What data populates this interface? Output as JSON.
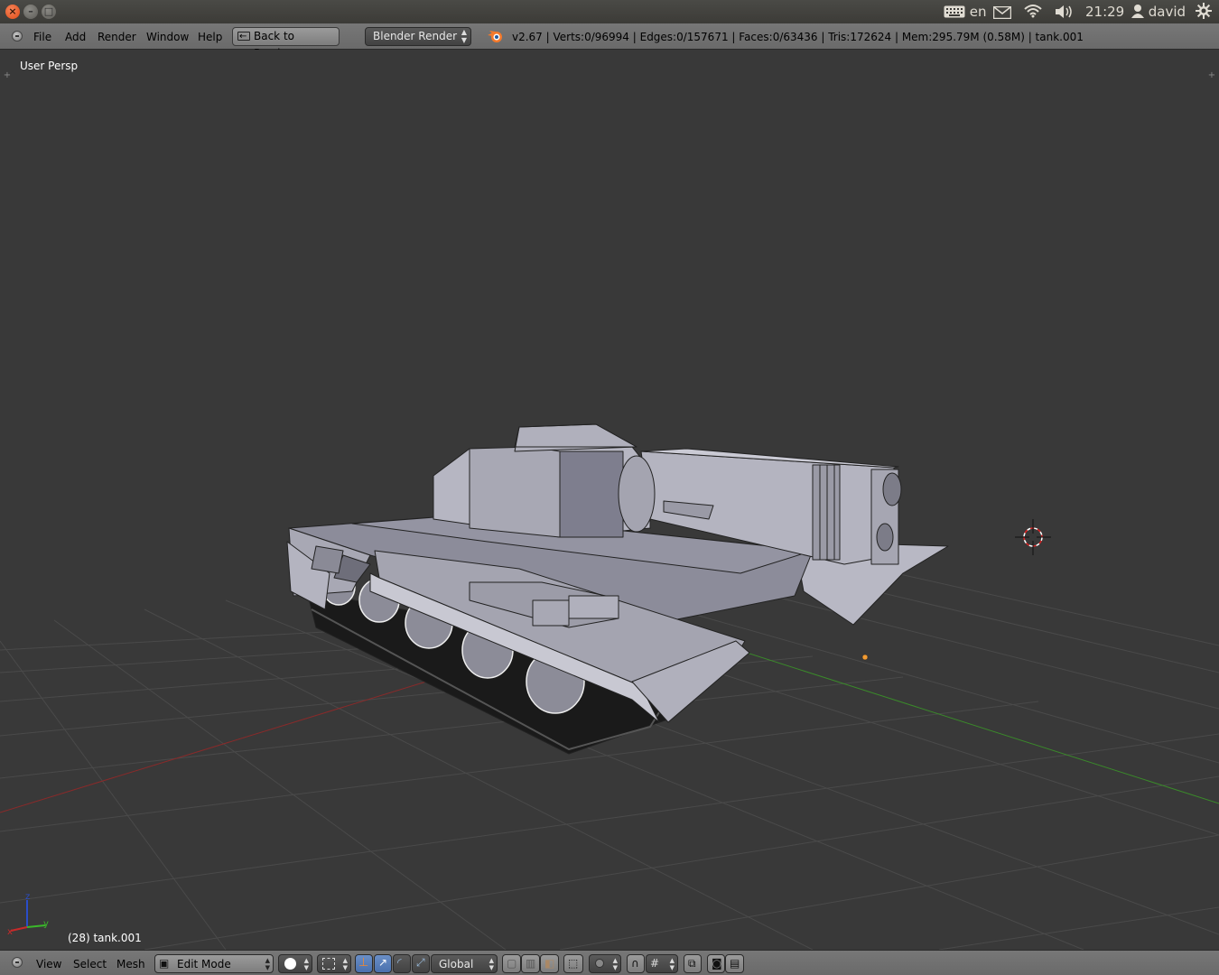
{
  "os_bar": {
    "window_buttons": {
      "close": "×",
      "minimize": "–",
      "maximize": "□"
    },
    "keyboard_layout": "en",
    "time": "21:29",
    "user": "david",
    "icons": [
      "keyboard-icon",
      "mail-icon",
      "wifi-icon",
      "volume-icon",
      "user-icon",
      "gear-icon"
    ]
  },
  "info_header": {
    "menus": [
      "File",
      "Add",
      "Render",
      "Window",
      "Help"
    ],
    "back_button": "Back to Previous",
    "render_engine": "Blender Render",
    "stats": "v2.67 | Verts:0/96994 | Edges:0/157671 | Faces:0/63436 | Tris:172624 | Mem:295.79M (0.58M) | tank.001"
  },
  "viewport": {
    "view_label": "User Persp",
    "object_label": "(28) tank.001",
    "axes": {
      "x": "x",
      "y": "y",
      "z": "z"
    },
    "colors": {
      "background": "#393939",
      "grid": "#4a4a4a",
      "x_axis": "#8a2a2a",
      "y_axis": "#3a8a2a",
      "mesh": "#9a9aa8"
    }
  },
  "view3d_header": {
    "menus": [
      "View",
      "Select",
      "Mesh"
    ],
    "mode": "Edit Mode",
    "orientation": "Global"
  }
}
